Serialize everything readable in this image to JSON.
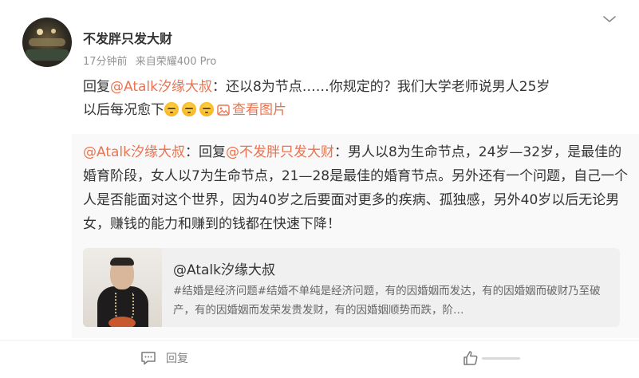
{
  "post": {
    "username": "不发胖只发大财",
    "time": "17分钟前",
    "source_prefix": "来自",
    "source_device": "荣耀400 Pro",
    "reply_prefix": "回复",
    "reply_mention": "@Atalk汐缘大叔",
    "reply_body_line1": "：还以8为节点……你规定的？我们大学老师说男人25岁",
    "reply_body_line2": "以后每况愈下",
    "emoji_names": [
      "doge-icon",
      "doge-icon",
      "doge-icon"
    ],
    "view_image_label": "查看图片"
  },
  "quote": {
    "author_mention": "@Atalk汐缘大叔",
    "reply_word": "：回复",
    "target_mention": "@不发胖只发大财",
    "text": "：男人以8为生命节点，24岁—32岁，是最佳的婚育阶段，女人以7为生命节点，21—28是最佳的婚育节点。另外还有一个问题，自己一个人是否能面对这个世界，因为40岁之后要面对更多的疾病、孤独感，另外40岁以后无论男女，赚钱的能力和赚到的钱都在快速下降！"
  },
  "card": {
    "title": "@Atalk汐缘大叔",
    "desc": "#结婚是经济问题#结婚不单纯是经济问题，有的因婚姻而发达，有的因婚姻而破财乃至破产，有的因婚姻而发荣发贵发财，有的因婚姻顺势而跌，阶…"
  },
  "actions": {
    "reply_label": "回复"
  },
  "colors": {
    "mention": "#eb7350",
    "quote_bg": "#f9f9f9",
    "card_bg": "#f0f0f0"
  }
}
